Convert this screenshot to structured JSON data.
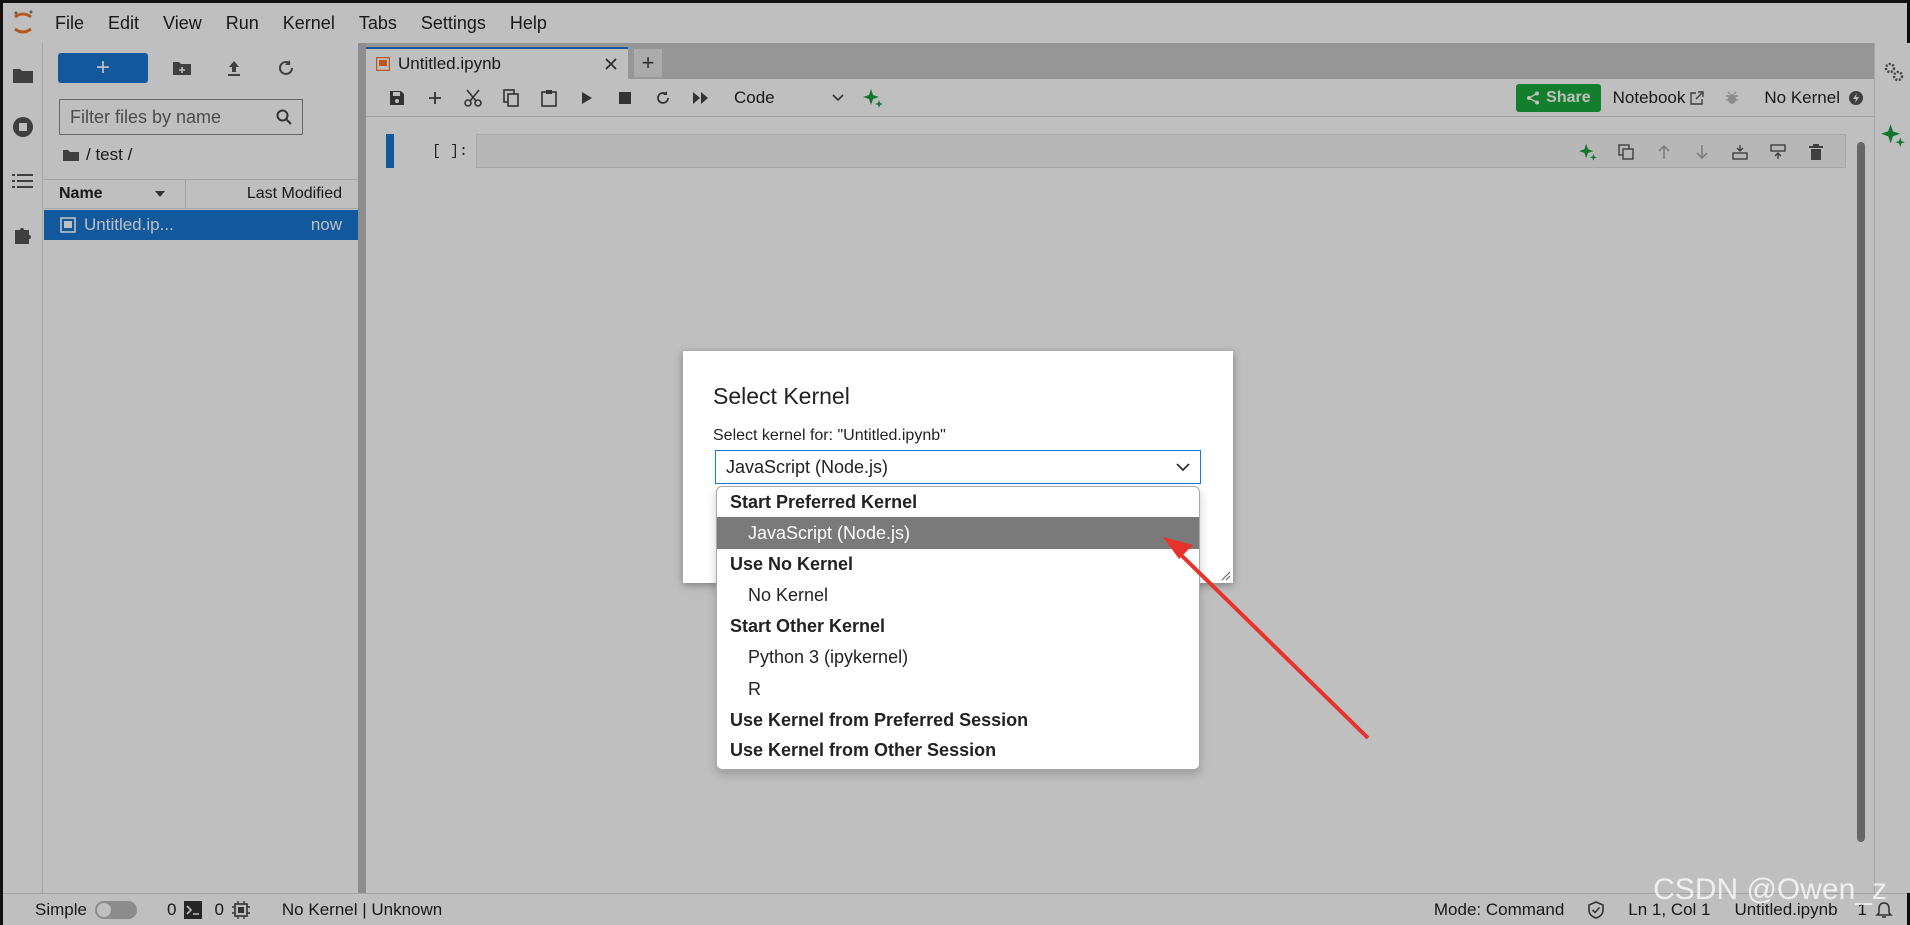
{
  "menubar": {
    "items": [
      "File",
      "Edit",
      "View",
      "Run",
      "Kernel",
      "Tabs",
      "Settings",
      "Help"
    ]
  },
  "filebrowser": {
    "new_label": "+",
    "filter_placeholder": "Filter files by name",
    "breadcrumb": "/ test /",
    "col_name": "Name",
    "col_modified": "Last Modified",
    "files": [
      {
        "name": "Untitled.ip...",
        "modified": "now"
      }
    ]
  },
  "notebook": {
    "tab_label": "Untitled.ipynb",
    "cell_type": "Code",
    "share_label": "Share",
    "notebook_label": "Notebook",
    "kernel_status": "No Kernel",
    "cell_prompt": "[ ]:"
  },
  "statusbar": {
    "mode_simple": "Simple",
    "terminals_count": "0",
    "kernels_count": "0",
    "kernel_info": "No Kernel | Unknown",
    "mode": "Mode: Command",
    "position": "Ln 1, Col 1",
    "filename": "Untitled.ipynb",
    "notifications": "1"
  },
  "dialog": {
    "title": "Select Kernel",
    "label": "Select kernel for: \"Untitled.ipynb\"",
    "selected": "JavaScript (Node.js)",
    "groups": [
      {
        "label": "Start Preferred Kernel",
        "options": [
          {
            "label": "JavaScript (Node.js)",
            "selected": true
          }
        ]
      },
      {
        "label": "Use No Kernel",
        "options": [
          {
            "label": "No Kernel",
            "selected": false
          }
        ]
      },
      {
        "label": "Start Other Kernel",
        "options": [
          {
            "label": "Python 3 (ipykernel)",
            "selected": false
          },
          {
            "label": "R",
            "selected": false
          }
        ]
      },
      {
        "label": "Use Kernel from Preferred Session",
        "options": []
      },
      {
        "label": "Use Kernel from Other Session",
        "options": []
      }
    ]
  },
  "watermark": "CSDN @Owen_z",
  "colors": {
    "accent": "#1976d2",
    "share_green": "#1aaa3d",
    "ai_green": "#1a9c3a",
    "selected_option": "#7a7a7a",
    "annotation_arrow": "#e8322c"
  }
}
